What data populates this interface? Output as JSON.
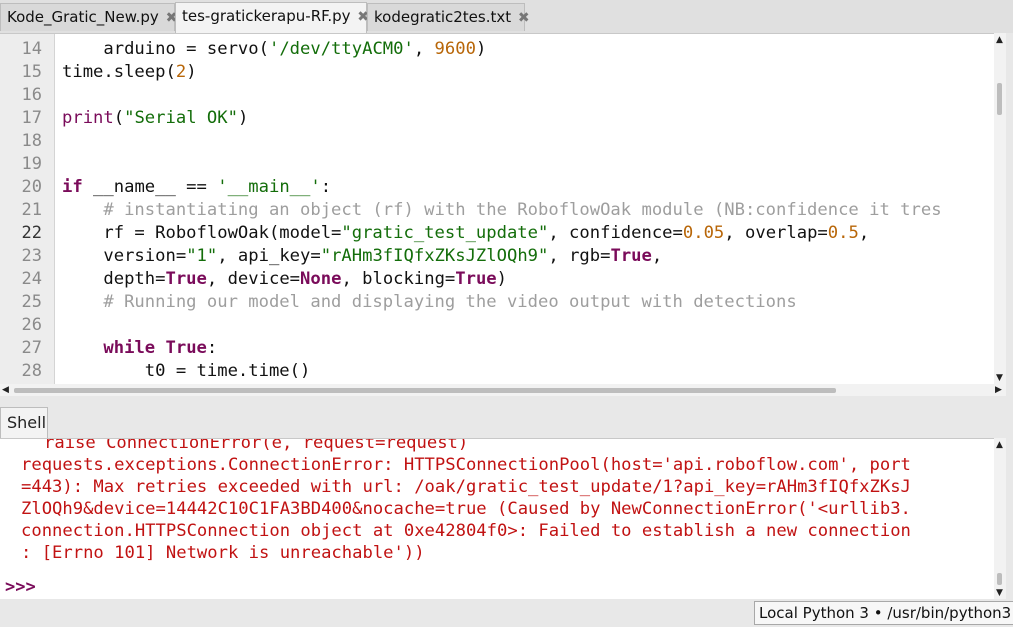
{
  "tabs": [
    {
      "label": "Kode_Gratic_New.py",
      "close": "✖",
      "active": false
    },
    {
      "label": "tes-gratickerapu-RF.py",
      "close": "✖",
      "active": true
    },
    {
      "label": "kodegratic2tes.txt",
      "close": "✖",
      "active": false
    }
  ],
  "editor": {
    "line_numbers": [
      "14",
      "15",
      "16",
      "17",
      "18",
      "19",
      "20",
      "21",
      "22",
      "23",
      "24",
      "25",
      "26",
      "27",
      "28"
    ],
    "current_line": "22"
  },
  "shell": {
    "tab_label": "Shell",
    "output_lines": [
      "raise ConnectionError(e, request=request)",
      "requests.exceptions.ConnectionError: HTTPSConnectionPool(host='api.roboflow.com', port",
      "=443): Max retries exceeded with url: /oak/gratic_test_update/1?api_key=rAHm3fIQfxZKsJ",
      "ZlOQh9&device=14442C10C1FA3BD400&nocache=true (Caused by NewConnectionError('<urllib3.",
      "connection.HTTPSConnection object at 0xe42804f0>: Failed to establish a new connection",
      ": [Errno 101] Network is unreachable'))"
    ],
    "prompt": ">>>"
  },
  "status": {
    "interpreter": "Local Python 3 • /usr/bin/python3"
  },
  "colors": {
    "keyword": "#7a0b5a",
    "string": "#136d0a",
    "number": "#b86608",
    "comment": "#9e9e9e",
    "error": "#c11212"
  }
}
